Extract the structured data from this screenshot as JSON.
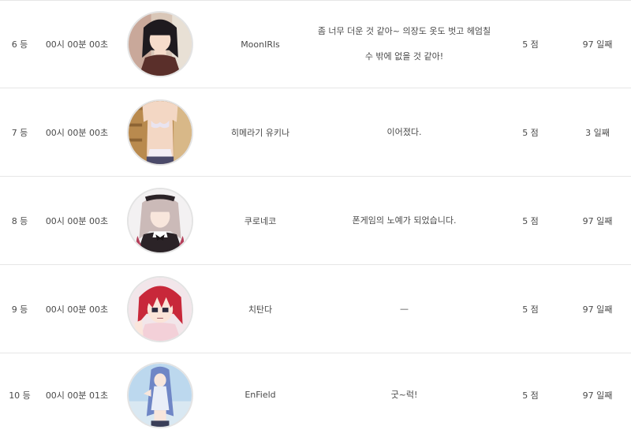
{
  "rows": [
    {
      "rank": "6 등",
      "time": "00시 00분 00초",
      "name": "MoonIRls",
      "message_line1": "좀 너무 더운 것 같아~ 의장도 옷도 벗고 헤엄칠",
      "message_line2": "수 밖에 없을 것 같아!",
      "score": "5 점",
      "days": "97 일째",
      "avatar_icon": "dark-hair-girl-avatar"
    },
    {
      "rank": "7 등",
      "time": "00시 00분 00초",
      "name": "히메라기 유키나",
      "message_line1": "이어졌다.",
      "message_line2": "",
      "score": "5 점",
      "days": "3 일째",
      "avatar_icon": "swimsuit-girl-avatar"
    },
    {
      "rank": "8 등",
      "time": "00시 00분 00초",
      "name": "쿠로네코",
      "message_line1": "폰게임의 노예가 되었습니다.",
      "message_line2": "",
      "score": "5 점",
      "days": "97 일째",
      "avatar_icon": "maid-girl-avatar"
    },
    {
      "rank": "9 등",
      "time": "00시 00분 00초",
      "name": "치탄다",
      "message_line1": "—",
      "message_line2": "",
      "score": "5 점",
      "days": "97 일째",
      "avatar_icon": "red-hair-girl-avatar"
    },
    {
      "rank": "10 등",
      "time": "00시 00분 01초",
      "name": "EnField",
      "message_line1": "굿~럭!",
      "message_line2": "",
      "score": "5 점",
      "days": "97 일째",
      "avatar_icon": "blue-hair-girl-avatar"
    }
  ],
  "colors": {
    "border": "#e6e6e6",
    "text": "#4a4a4a",
    "avatar_ring": "#e3e3e3"
  }
}
